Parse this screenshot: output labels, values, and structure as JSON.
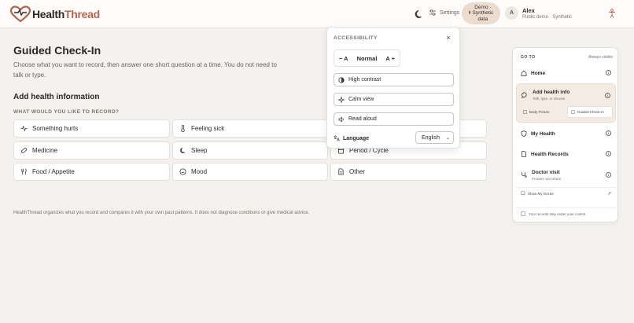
{
  "header": {
    "brand_part1": "Health",
    "brand_part2": "Thread",
    "settings_label": "Settings",
    "demo_badge_line1": "Demo ·",
    "demo_badge_line2": "Synthetic",
    "demo_badge_line3": "data",
    "user_initial": "A",
    "user_name": "Alex",
    "user_sub": "Public demo · Synthetic"
  },
  "main": {
    "title": "Guided Check-In",
    "description": "Choose what you want to record, then answer one short question at a time. You do not need to talk or type.",
    "section_title": "Add health information",
    "section_sub": "WHAT WOULD YOU LIKE TO RECORD?",
    "options": [
      {
        "label": "Something hurts",
        "icon": "pulse-icon"
      },
      {
        "label": "Feeling sick",
        "icon": "thermometer-icon"
      },
      {
        "label": "Medicine",
        "icon": "pill-icon"
      },
      {
        "label": "Sleep",
        "icon": "moon-icon"
      },
      {
        "label": "Period / Cycle",
        "icon": "calendar-icon"
      },
      {
        "label": "Food / Appetite",
        "icon": "utensils-icon"
      },
      {
        "label": "Mood",
        "icon": "smile-icon"
      },
      {
        "label": "Other",
        "icon": "document-icon"
      }
    ],
    "footer_note": "HealthThread organizes what you record and compares it with your own past patterns. It does not diagnose conditions or give medical advice."
  },
  "accessibility": {
    "title": "ACCESSIBILITY",
    "close": "×",
    "decrease": "− A",
    "size_value": "Normal",
    "increase": "A +",
    "high_contrast": "High contrast",
    "calm_view": "Calm view",
    "read_aloud": "Read aloud",
    "language_label": "Language",
    "language_value": "English"
  },
  "nav": {
    "heading": "GO TO",
    "visibility": "Always visible",
    "home": "Home",
    "add_info": "Add health info",
    "add_info_sub": "Talk, type, or choose",
    "body_picture": "Body Picture",
    "guided_checkin": "Guided Check-In",
    "my_health": "My Health",
    "health_records": "Health Records",
    "doctor_visit": "Doctor visit",
    "doctor_visit_sub": "Prepare and share",
    "show_doctor": "Show My Doctor",
    "records_note": "Your records stay under your control."
  },
  "colors": {
    "accent": "#b5644f",
    "badge_bg": "#ecdcd0",
    "active_nav_bg": "#f4ece4"
  }
}
